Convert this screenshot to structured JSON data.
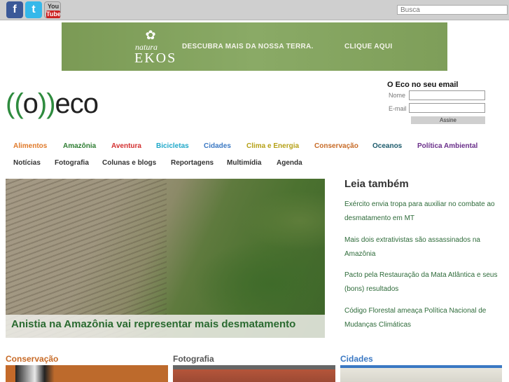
{
  "topbar": {
    "social": [
      {
        "icon": "facebook-icon",
        "glyph": "f"
      },
      {
        "icon": "twitter-icon",
        "glyph": "t"
      },
      {
        "icon": "youtube-icon",
        "glyph_top": "You",
        "glyph_bottom": "Tube"
      }
    ],
    "search_placeholder": "Busca"
  },
  "banner": {
    "brand_top": "natura",
    "brand": "EKOS",
    "slogan": "DESCUBRA MAIS DA NOSSA TERRA.",
    "cta": "CLIQUE AQUI"
  },
  "site": {
    "logo_open": "((",
    "logo_o": "o",
    "logo_close": "))",
    "logo_name": "eco"
  },
  "newsletter": {
    "title": "O Eco no seu email",
    "name_label": "Nome",
    "email_label": "E-mail",
    "button": "Assine"
  },
  "nav_primary": [
    {
      "label": "Alimentos",
      "color": "#e07a2a"
    },
    {
      "label": "Amazônia",
      "color": "#2e7d32"
    },
    {
      "label": "Aventura",
      "color": "#d32f2f"
    },
    {
      "label": "Bicicletas",
      "color": "#1fa8c9"
    },
    {
      "label": "Cidades",
      "color": "#3a78c3"
    },
    {
      "label": "Clima e Energia",
      "color": "#b5a016"
    },
    {
      "label": "Conservação",
      "color": "#c76a26"
    },
    {
      "label": "Oceanos",
      "color": "#1b5a6b"
    },
    {
      "label": "Política Ambiental",
      "color": "#6a2f8a"
    }
  ],
  "nav_secondary": [
    "Notícias",
    "Fotografia",
    "Colunas e blogs",
    "Reportagens",
    "Multimídia",
    "Agenda"
  ],
  "hero": {
    "caption": "Anistia na Amazônia vai representar mais desmatamento"
  },
  "sidebar": {
    "title": "Leia também",
    "links": [
      "Exército envia tropa para auxiliar no combate ao desmatamento em MT",
      "Mais dois extrativistas são assassinados na Amazônia",
      "Pacto pela Restauração da Mata Atlântica e seus (bons) resultados",
      "Código Florestal ameaça Política Nacional de Mudanças Climáticas"
    ]
  },
  "sections": [
    {
      "title": "Conservação",
      "color": "#c76a26"
    },
    {
      "title": "Fotografia",
      "color": "#555555"
    },
    {
      "title": "Cidades",
      "color": "#3a78c3"
    }
  ]
}
